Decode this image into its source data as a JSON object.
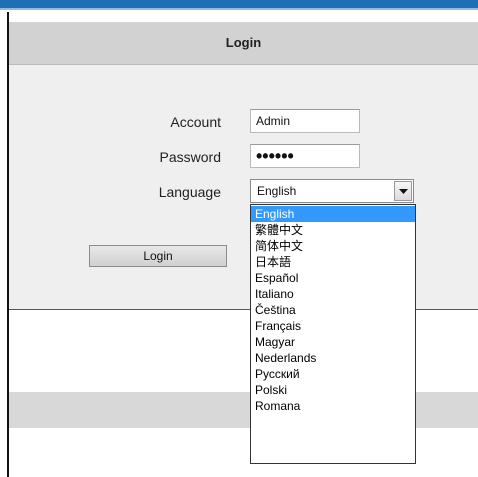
{
  "header": {
    "title": "Login"
  },
  "form": {
    "account": {
      "label": "Account",
      "value": "Admin"
    },
    "password": {
      "label": "Password",
      "value": "••••••"
    },
    "language": {
      "label": "Language",
      "selected": "English",
      "options": [
        "English",
        "繁體中文",
        "简体中文",
        "日本語",
        "Español",
        "Italiano",
        "Čeština",
        "Français",
        "Magyar",
        "Nederlands",
        "Русский",
        "Polski",
        "Romana"
      ],
      "highlighted_option": "English"
    },
    "login_button": "Login"
  },
  "colors": {
    "accent_top_bar": "#1e6fb8",
    "header_bg": "#d2d2d2",
    "panel_bg": "#efefef",
    "selection": "#3399ff"
  },
  "icons": {
    "dropdown_arrow": "chevron-down-icon"
  }
}
